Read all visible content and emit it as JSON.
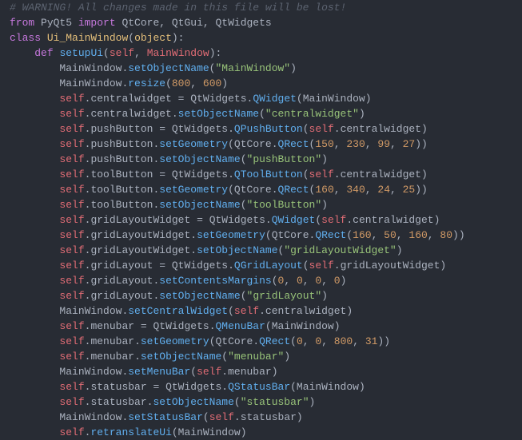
{
  "lines": [
    {
      "indent": "",
      "tokens": [
        {
          "t": "# WARNING! All changes made in this file will be lost!",
          "c": "comment"
        }
      ]
    },
    {
      "indent": "",
      "tokens": [
        {
          "t": "from",
          "c": "keyword"
        },
        {
          "t": " PyQt5 ",
          "c": "name"
        },
        {
          "t": "import",
          "c": "keyword"
        },
        {
          "t": " QtCore",
          "c": "name"
        },
        {
          "t": ",",
          "c": "punct"
        },
        {
          "t": " QtGui",
          "c": "name"
        },
        {
          "t": ",",
          "c": "punct"
        },
        {
          "t": " QtWidgets",
          "c": "name"
        }
      ]
    },
    {
      "indent": "",
      "tokens": [
        {
          "t": "class",
          "c": "keyword"
        },
        {
          "t": " ",
          "c": "punct"
        },
        {
          "t": "Ui_MainWindow",
          "c": "classname"
        },
        {
          "t": "(",
          "c": "punct"
        },
        {
          "t": "object",
          "c": "builtin"
        },
        {
          "t": "):",
          "c": "punct"
        }
      ]
    },
    {
      "indent": "    ",
      "tokens": [
        {
          "t": "def",
          "c": "keyword"
        },
        {
          "t": " ",
          "c": "punct"
        },
        {
          "t": "setupUi",
          "c": "function"
        },
        {
          "t": "(",
          "c": "punct"
        },
        {
          "t": "self",
          "c": "self"
        },
        {
          "t": ", ",
          "c": "punct"
        },
        {
          "t": "MainWindow",
          "c": "param"
        },
        {
          "t": "):",
          "c": "punct"
        }
      ]
    },
    {
      "indent": "        ",
      "tokens": [
        {
          "t": "MainWindow",
          "c": "name"
        },
        {
          "t": ".",
          "c": "punct"
        },
        {
          "t": "setObjectName",
          "c": "method"
        },
        {
          "t": "(",
          "c": "punct"
        },
        {
          "t": "\"MainWindow\"",
          "c": "string"
        },
        {
          "t": ")",
          "c": "punct"
        }
      ]
    },
    {
      "indent": "        ",
      "tokens": [
        {
          "t": "MainWindow",
          "c": "name"
        },
        {
          "t": ".",
          "c": "punct"
        },
        {
          "t": "resize",
          "c": "method"
        },
        {
          "t": "(",
          "c": "punct"
        },
        {
          "t": "800",
          "c": "number"
        },
        {
          "t": ", ",
          "c": "punct"
        },
        {
          "t": "600",
          "c": "number"
        },
        {
          "t": ")",
          "c": "punct"
        }
      ]
    },
    {
      "indent": "        ",
      "tokens": [
        {
          "t": "self",
          "c": "self"
        },
        {
          "t": ".centralwidget ",
          "c": "name"
        },
        {
          "t": "=",
          "c": "punct"
        },
        {
          "t": " QtWidgets",
          "c": "name"
        },
        {
          "t": ".",
          "c": "punct"
        },
        {
          "t": "QWidget",
          "c": "method"
        },
        {
          "t": "(MainWindow)",
          "c": "punct"
        }
      ]
    },
    {
      "indent": "        ",
      "tokens": [
        {
          "t": "self",
          "c": "self"
        },
        {
          "t": ".centralwidget",
          "c": "name"
        },
        {
          "t": ".",
          "c": "punct"
        },
        {
          "t": "setObjectName",
          "c": "method"
        },
        {
          "t": "(",
          "c": "punct"
        },
        {
          "t": "\"centralwidget\"",
          "c": "string"
        },
        {
          "t": ")",
          "c": "punct"
        }
      ]
    },
    {
      "indent": "        ",
      "tokens": [
        {
          "t": "self",
          "c": "self"
        },
        {
          "t": ".pushButton ",
          "c": "name"
        },
        {
          "t": "=",
          "c": "punct"
        },
        {
          "t": " QtWidgets",
          "c": "name"
        },
        {
          "t": ".",
          "c": "punct"
        },
        {
          "t": "QPushButton",
          "c": "method"
        },
        {
          "t": "(",
          "c": "punct"
        },
        {
          "t": "self",
          "c": "self"
        },
        {
          "t": ".centralwidget)",
          "c": "punct"
        }
      ]
    },
    {
      "indent": "        ",
      "tokens": [
        {
          "t": "self",
          "c": "self"
        },
        {
          "t": ".pushButton",
          "c": "name"
        },
        {
          "t": ".",
          "c": "punct"
        },
        {
          "t": "setGeometry",
          "c": "method"
        },
        {
          "t": "(QtCore",
          "c": "punct"
        },
        {
          "t": ".",
          "c": "punct"
        },
        {
          "t": "QRect",
          "c": "method"
        },
        {
          "t": "(",
          "c": "punct"
        },
        {
          "t": "150",
          "c": "number"
        },
        {
          "t": ", ",
          "c": "punct"
        },
        {
          "t": "230",
          "c": "number"
        },
        {
          "t": ", ",
          "c": "punct"
        },
        {
          "t": "99",
          "c": "number"
        },
        {
          "t": ", ",
          "c": "punct"
        },
        {
          "t": "27",
          "c": "number"
        },
        {
          "t": "))",
          "c": "punct"
        }
      ]
    },
    {
      "indent": "        ",
      "tokens": [
        {
          "t": "self",
          "c": "self"
        },
        {
          "t": ".pushButton",
          "c": "name"
        },
        {
          "t": ".",
          "c": "punct"
        },
        {
          "t": "setObjectName",
          "c": "method"
        },
        {
          "t": "(",
          "c": "punct"
        },
        {
          "t": "\"pushButton\"",
          "c": "string"
        },
        {
          "t": ")",
          "c": "punct"
        }
      ]
    },
    {
      "indent": "        ",
      "tokens": [
        {
          "t": "self",
          "c": "self"
        },
        {
          "t": ".toolButton ",
          "c": "name"
        },
        {
          "t": "=",
          "c": "punct"
        },
        {
          "t": " QtWidgets",
          "c": "name"
        },
        {
          "t": ".",
          "c": "punct"
        },
        {
          "t": "QToolButton",
          "c": "method"
        },
        {
          "t": "(",
          "c": "punct"
        },
        {
          "t": "self",
          "c": "self"
        },
        {
          "t": ".centralwidget)",
          "c": "punct"
        }
      ]
    },
    {
      "indent": "        ",
      "tokens": [
        {
          "t": "self",
          "c": "self"
        },
        {
          "t": ".toolButton",
          "c": "name"
        },
        {
          "t": ".",
          "c": "punct"
        },
        {
          "t": "setGeometry",
          "c": "method"
        },
        {
          "t": "(QtCore",
          "c": "punct"
        },
        {
          "t": ".",
          "c": "punct"
        },
        {
          "t": "QRect",
          "c": "method"
        },
        {
          "t": "(",
          "c": "punct"
        },
        {
          "t": "160",
          "c": "number"
        },
        {
          "t": ", ",
          "c": "punct"
        },
        {
          "t": "340",
          "c": "number"
        },
        {
          "t": ", ",
          "c": "punct"
        },
        {
          "t": "24",
          "c": "number"
        },
        {
          "t": ", ",
          "c": "punct"
        },
        {
          "t": "25",
          "c": "number"
        },
        {
          "t": "))",
          "c": "punct"
        }
      ]
    },
    {
      "indent": "        ",
      "tokens": [
        {
          "t": "self",
          "c": "self"
        },
        {
          "t": ".toolButton",
          "c": "name"
        },
        {
          "t": ".",
          "c": "punct"
        },
        {
          "t": "setObjectName",
          "c": "method"
        },
        {
          "t": "(",
          "c": "punct"
        },
        {
          "t": "\"toolButton\"",
          "c": "string"
        },
        {
          "t": ")",
          "c": "punct"
        }
      ]
    },
    {
      "indent": "        ",
      "tokens": [
        {
          "t": "self",
          "c": "self"
        },
        {
          "t": ".gridLayoutWidget ",
          "c": "name"
        },
        {
          "t": "=",
          "c": "punct"
        },
        {
          "t": " QtWidgets",
          "c": "name"
        },
        {
          "t": ".",
          "c": "punct"
        },
        {
          "t": "QWidget",
          "c": "method"
        },
        {
          "t": "(",
          "c": "punct"
        },
        {
          "t": "self",
          "c": "self"
        },
        {
          "t": ".centralwidget)",
          "c": "punct"
        }
      ]
    },
    {
      "indent": "        ",
      "tokens": [
        {
          "t": "self",
          "c": "self"
        },
        {
          "t": ".gridLayoutWidget",
          "c": "name"
        },
        {
          "t": ".",
          "c": "punct"
        },
        {
          "t": "setGeometry",
          "c": "method"
        },
        {
          "t": "(QtCore",
          "c": "punct"
        },
        {
          "t": ".",
          "c": "punct"
        },
        {
          "t": "QRect",
          "c": "method"
        },
        {
          "t": "(",
          "c": "punct"
        },
        {
          "t": "160",
          "c": "number"
        },
        {
          "t": ", ",
          "c": "punct"
        },
        {
          "t": "50",
          "c": "number"
        },
        {
          "t": ", ",
          "c": "punct"
        },
        {
          "t": "160",
          "c": "number"
        },
        {
          "t": ", ",
          "c": "punct"
        },
        {
          "t": "80",
          "c": "number"
        },
        {
          "t": "))",
          "c": "punct"
        }
      ]
    },
    {
      "indent": "        ",
      "tokens": [
        {
          "t": "self",
          "c": "self"
        },
        {
          "t": ".gridLayoutWidget",
          "c": "name"
        },
        {
          "t": ".",
          "c": "punct"
        },
        {
          "t": "setObjectName",
          "c": "method"
        },
        {
          "t": "(",
          "c": "punct"
        },
        {
          "t": "\"gridLayoutWidget\"",
          "c": "string"
        },
        {
          "t": ")",
          "c": "punct"
        }
      ]
    },
    {
      "indent": "        ",
      "tokens": [
        {
          "t": "self",
          "c": "self"
        },
        {
          "t": ".gridLayout ",
          "c": "name"
        },
        {
          "t": "=",
          "c": "punct"
        },
        {
          "t": " QtWidgets",
          "c": "name"
        },
        {
          "t": ".",
          "c": "punct"
        },
        {
          "t": "QGridLayout",
          "c": "method"
        },
        {
          "t": "(",
          "c": "punct"
        },
        {
          "t": "self",
          "c": "self"
        },
        {
          "t": ".gridLayoutWidget)",
          "c": "punct"
        }
      ]
    },
    {
      "indent": "        ",
      "tokens": [
        {
          "t": "self",
          "c": "self"
        },
        {
          "t": ".gridLayout",
          "c": "name"
        },
        {
          "t": ".",
          "c": "punct"
        },
        {
          "t": "setContentsMargins",
          "c": "method"
        },
        {
          "t": "(",
          "c": "punct"
        },
        {
          "t": "0",
          "c": "number"
        },
        {
          "t": ", ",
          "c": "punct"
        },
        {
          "t": "0",
          "c": "number"
        },
        {
          "t": ", ",
          "c": "punct"
        },
        {
          "t": "0",
          "c": "number"
        },
        {
          "t": ", ",
          "c": "punct"
        },
        {
          "t": "0",
          "c": "number"
        },
        {
          "t": ")",
          "c": "punct"
        }
      ]
    },
    {
      "indent": "        ",
      "tokens": [
        {
          "t": "self",
          "c": "self"
        },
        {
          "t": ".gridLayout",
          "c": "name"
        },
        {
          "t": ".",
          "c": "punct"
        },
        {
          "t": "setObjectName",
          "c": "method"
        },
        {
          "t": "(",
          "c": "punct"
        },
        {
          "t": "\"gridLayout\"",
          "c": "string"
        },
        {
          "t": ")",
          "c": "punct"
        }
      ]
    },
    {
      "indent": "        ",
      "tokens": [
        {
          "t": "MainWindow",
          "c": "name"
        },
        {
          "t": ".",
          "c": "punct"
        },
        {
          "t": "setCentralWidget",
          "c": "method"
        },
        {
          "t": "(",
          "c": "punct"
        },
        {
          "t": "self",
          "c": "self"
        },
        {
          "t": ".centralwidget)",
          "c": "punct"
        }
      ]
    },
    {
      "indent": "        ",
      "tokens": [
        {
          "t": "self",
          "c": "self"
        },
        {
          "t": ".menubar ",
          "c": "name"
        },
        {
          "t": "=",
          "c": "punct"
        },
        {
          "t": " QtWidgets",
          "c": "name"
        },
        {
          "t": ".",
          "c": "punct"
        },
        {
          "t": "QMenuBar",
          "c": "method"
        },
        {
          "t": "(MainWindow)",
          "c": "punct"
        }
      ]
    },
    {
      "indent": "        ",
      "tokens": [
        {
          "t": "self",
          "c": "self"
        },
        {
          "t": ".menubar",
          "c": "name"
        },
        {
          "t": ".",
          "c": "punct"
        },
        {
          "t": "setGeometry",
          "c": "method"
        },
        {
          "t": "(QtCore",
          "c": "punct"
        },
        {
          "t": ".",
          "c": "punct"
        },
        {
          "t": "QRect",
          "c": "method"
        },
        {
          "t": "(",
          "c": "punct"
        },
        {
          "t": "0",
          "c": "number"
        },
        {
          "t": ", ",
          "c": "punct"
        },
        {
          "t": "0",
          "c": "number"
        },
        {
          "t": ", ",
          "c": "punct"
        },
        {
          "t": "800",
          "c": "number"
        },
        {
          "t": ", ",
          "c": "punct"
        },
        {
          "t": "31",
          "c": "number"
        },
        {
          "t": "))",
          "c": "punct"
        }
      ]
    },
    {
      "indent": "        ",
      "tokens": [
        {
          "t": "self",
          "c": "self"
        },
        {
          "t": ".menubar",
          "c": "name"
        },
        {
          "t": ".",
          "c": "punct"
        },
        {
          "t": "setObjectName",
          "c": "method"
        },
        {
          "t": "(",
          "c": "punct"
        },
        {
          "t": "\"menubar\"",
          "c": "string"
        },
        {
          "t": ")",
          "c": "punct"
        }
      ]
    },
    {
      "indent": "        ",
      "tokens": [
        {
          "t": "MainWindow",
          "c": "name"
        },
        {
          "t": ".",
          "c": "punct"
        },
        {
          "t": "setMenuBar",
          "c": "method"
        },
        {
          "t": "(",
          "c": "punct"
        },
        {
          "t": "self",
          "c": "self"
        },
        {
          "t": ".menubar)",
          "c": "punct"
        }
      ]
    },
    {
      "indent": "        ",
      "tokens": [
        {
          "t": "self",
          "c": "self"
        },
        {
          "t": ".statusbar ",
          "c": "name"
        },
        {
          "t": "=",
          "c": "punct"
        },
        {
          "t": " QtWidgets",
          "c": "name"
        },
        {
          "t": ".",
          "c": "punct"
        },
        {
          "t": "QStatusBar",
          "c": "method"
        },
        {
          "t": "(MainWindow)",
          "c": "punct"
        }
      ]
    },
    {
      "indent": "        ",
      "tokens": [
        {
          "t": "self",
          "c": "self"
        },
        {
          "t": ".statusbar",
          "c": "name"
        },
        {
          "t": ".",
          "c": "punct"
        },
        {
          "t": "setObjectName",
          "c": "method"
        },
        {
          "t": "(",
          "c": "punct"
        },
        {
          "t": "\"statusbar\"",
          "c": "string"
        },
        {
          "t": ")",
          "c": "punct"
        }
      ]
    },
    {
      "indent": "        ",
      "tokens": [
        {
          "t": "MainWindow",
          "c": "name"
        },
        {
          "t": ".",
          "c": "punct"
        },
        {
          "t": "setStatusBar",
          "c": "method"
        },
        {
          "t": "(",
          "c": "punct"
        },
        {
          "t": "self",
          "c": "self"
        },
        {
          "t": ".statusbar)",
          "c": "punct"
        }
      ]
    },
    {
      "indent": "        ",
      "tokens": [
        {
          "t": "self",
          "c": "self"
        },
        {
          "t": ".",
          "c": "punct"
        },
        {
          "t": "retranslateUi",
          "c": "method"
        },
        {
          "t": "(MainWindow)",
          "c": "punct"
        }
      ]
    }
  ]
}
